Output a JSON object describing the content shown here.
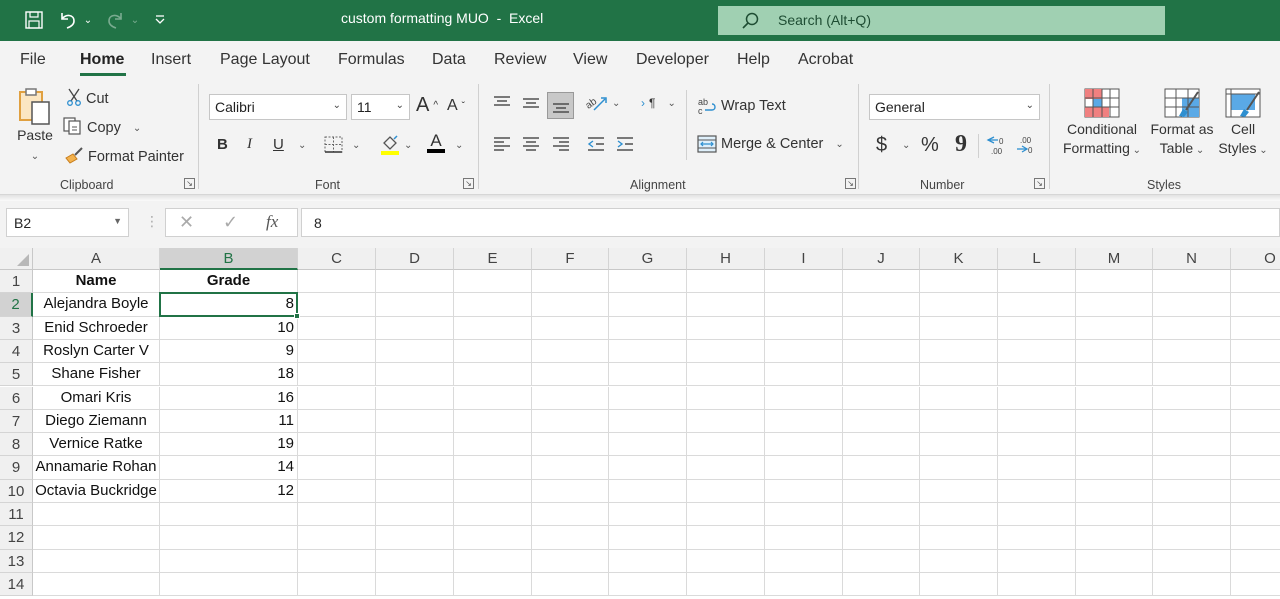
{
  "titlebar": {
    "title": "custom formatting MUO  -  Excel",
    "search_placeholder": "Search (Alt+Q)",
    "icons": [
      "save-icon",
      "undo-icon",
      "redo-icon",
      "customize-qat-icon",
      "search-icon"
    ]
  },
  "menu": {
    "items": [
      "File",
      "Home",
      "Insert",
      "Page Layout",
      "Formulas",
      "Data",
      "Review",
      "View",
      "Developer",
      "Help",
      "Acrobat"
    ],
    "active": "Home"
  },
  "ribbon": {
    "clipboard": {
      "label": "Clipboard",
      "paste": "Paste",
      "cut": "Cut",
      "copy": "Copy",
      "format_painter": "Format Painter"
    },
    "font": {
      "label": "Font",
      "font_name": "Calibri",
      "font_size": "11",
      "bold": "B",
      "italic": "I",
      "underline": "U",
      "grow": "A",
      "shrink": "A",
      "font_color": "A",
      "highlight_color": "#ffff00",
      "text_color": "#000000"
    },
    "alignment": {
      "label": "Alignment",
      "wrap_text": "Wrap Text",
      "merge_center": "Merge & Center"
    },
    "number": {
      "label": "Number",
      "format": "General",
      "currency": "$",
      "percent": "%",
      "comma": "9"
    },
    "styles": {
      "label": "Styles",
      "conditional_formatting": [
        "Conditional",
        "Formatting"
      ],
      "format_as_table": [
        "Format as",
        "Table"
      ],
      "cell_styles": [
        "Cell",
        "Styles"
      ]
    }
  },
  "formula_bar": {
    "name_box": "B2",
    "fx": "fx",
    "value": "8"
  },
  "sheet": {
    "columns": [
      "A",
      "B",
      "C",
      "D",
      "E",
      "F",
      "G",
      "H",
      "I",
      "J",
      "K",
      "L",
      "M",
      "N",
      "O"
    ],
    "rows": [
      "1",
      "2",
      "3",
      "4",
      "5",
      "6",
      "7",
      "8",
      "9",
      "10",
      "11",
      "12",
      "13",
      "14"
    ],
    "selected_cell": "B2",
    "header": {
      "name": "Name",
      "grade": "Grade"
    },
    "data": [
      {
        "name": "Alejandra Boyle",
        "grade": "8"
      },
      {
        "name": "Enid Schroeder",
        "grade": "10"
      },
      {
        "name": "Roslyn Carter V",
        "grade": "9"
      },
      {
        "name": "Shane Fisher",
        "grade": "18"
      },
      {
        "name": "Omari Kris",
        "grade": "16"
      },
      {
        "name": "Diego Ziemann",
        "grade": "11"
      },
      {
        "name": "Vernice Ratke",
        "grade": "19"
      },
      {
        "name": "Annamarie Rohan",
        "grade": "14"
      },
      {
        "name": "Octavia Buckridge",
        "grade": "12"
      }
    ]
  },
  "colors": {
    "accent": "#217346",
    "search_bg": "#a0d0b2"
  }
}
